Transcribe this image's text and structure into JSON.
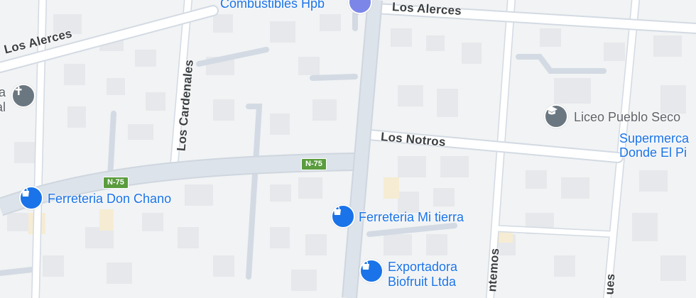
{
  "colors": {
    "background": "#f1f3f4",
    "road": "#ffffff",
    "road_edge": "#d3dae3",
    "block": "#e3e6ea",
    "poi_blue": "#1a73e8",
    "poi_gray": "#6b7780",
    "route_shield": "#5a9c3e"
  },
  "streets": {
    "los_alerces_right": "Los Alerces",
    "los_alerces_left": "Los Alerces",
    "los_cardenales": "Los Cardenales",
    "los_notros": "Los Notros",
    "antemos_partial": "ntemos",
    "ues_partial": "ues"
  },
  "route_shields": [
    "N-75",
    "N-75"
  ],
  "pois": {
    "combustibles": {
      "label": "Combustibles Hpb",
      "icon": "gas-station-icon"
    },
    "iglesia": {
      "label_line1": "a",
      "label_line2": "al",
      "icon": "church-cross-icon"
    },
    "liceo": {
      "label": "Liceo Pueblo Seco",
      "icon": "school-icon"
    },
    "supermercado": {
      "label_line1": "Supermerca",
      "label_line2": "Donde El Pi"
    },
    "ferreteria_don_chano": {
      "label": "Ferreteria Don Chano",
      "icon": "shopping-bag-icon"
    },
    "ferreteria_mi_tierra": {
      "label": "Ferreteria Mi tierra",
      "icon": "shopping-bag-icon"
    },
    "exportadora": {
      "label_line1": "Exportadora",
      "label_line2": "Biofruit Ltda",
      "icon": "shopping-bag-icon"
    }
  }
}
